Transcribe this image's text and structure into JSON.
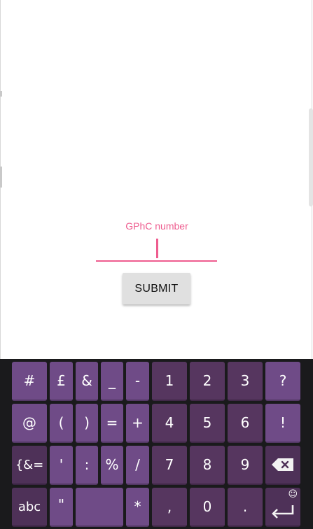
{
  "form": {
    "field_label": "GPhC number",
    "field_value": "",
    "submit_label": "SUBMIT"
  },
  "colors": {
    "accent": "#ee5d8f",
    "keyboard_background": "#1a1a1c",
    "symbol_key": "#6f4b87",
    "number_key": "#56365f",
    "function_key": "#4e3158"
  },
  "keyboard": {
    "row1": [
      "#",
      "£",
      "&",
      "_",
      "-",
      "1",
      "2",
      "3",
      "?"
    ],
    "row2": [
      "@",
      "(",
      ")",
      "=",
      "+",
      "4",
      "5",
      "6",
      "!"
    ],
    "row3": [
      "{&=",
      "'",
      ":",
      "%",
      "/",
      "7",
      "8",
      "9"
    ],
    "row3_backspace_icon": "backspace-icon",
    "row4": [
      "abc",
      "\"",
      "",
      "*",
      ",",
      "0",
      "."
    ],
    "row4_space_label": "",
    "row4_enter_icon": "enter-icon",
    "row4_emoji_icon": "emoji-icon"
  }
}
